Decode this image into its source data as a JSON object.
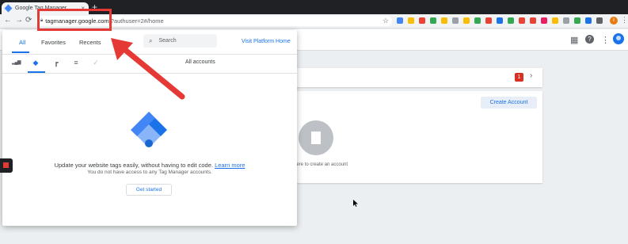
{
  "browser": {
    "tab_title": "Google Tag Manager",
    "tab_close": "×",
    "new_tab": "+",
    "back": "←",
    "forward": "→",
    "reload": "⟳",
    "url_host": "tagmanager.google.com",
    "url_path": "/?authuser=2#/home",
    "star": "☆",
    "profile_initial": "I",
    "menu": "⋮",
    "extension_colors": [
      "#4285f4",
      "#fbbc04",
      "#ea4335",
      "#34a853",
      "#fbbc04",
      "#9aa0a6",
      "#fbbc04",
      "#34a853",
      "#ea4335",
      "#1a73e8",
      "#34a853",
      "#ea4335",
      "#ea4335",
      "#e91e63",
      "#fbbc04",
      "#9aa0a6",
      "#34a853",
      "#1a73e8",
      "#5f6368"
    ]
  },
  "header": {
    "apps_icon": "▦",
    "help_icon": "?",
    "more_icon": "⋮"
  },
  "panel": {
    "tabs": [
      "All",
      "Favorites",
      "Recents"
    ],
    "search_placeholder": "Search",
    "search_icon": "⌕",
    "visit_link": "Visit Platform Home",
    "product_icons": [
      "analytics-icon",
      "tag-manager-icon",
      "optimize-icon",
      "data-studio-icon",
      "surveys-icon"
    ],
    "product_glyphs": [
      "▂▄▆",
      "◆",
      "┏",
      "≡",
      "✓"
    ],
    "all_accounts": "All accounts",
    "tagline": "Update your website tags easily, without having to edit code.",
    "learn_more": "Learn more",
    "no_access": "You do not have access to any Tag Manager accounts.",
    "get_started": "Get started"
  },
  "background": {
    "badge_count": "1",
    "chevron": "›",
    "create_account": "Create Account",
    "create_text": "here to create an account"
  },
  "colors": {
    "accent": "#1a73e8",
    "annotation": "#e53935"
  }
}
